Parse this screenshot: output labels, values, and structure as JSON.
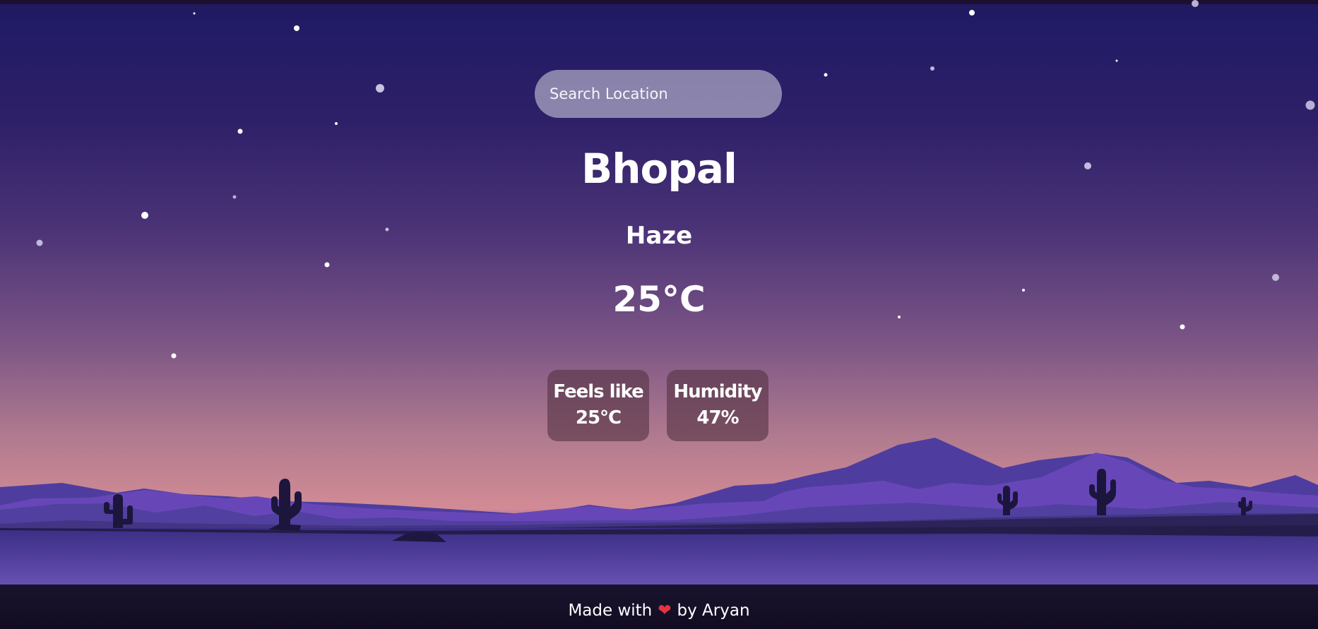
{
  "search": {
    "placeholder": "Search Location"
  },
  "weather": {
    "city": "Bhopal",
    "condition": "Haze",
    "temperature": "25°C",
    "feels_like": {
      "label": "Feels like",
      "value": "25°C"
    },
    "humidity": {
      "label": "Humidity",
      "value": "47%"
    }
  },
  "footer": {
    "prefix": "Made with",
    "heart": "❤",
    "suffix": "by Aryan"
  },
  "colors": {
    "sky_top": "#1f1a5e",
    "sky_bottom": "#d28b95",
    "footer_bg": "#120c22",
    "heart": "#e8323f"
  }
}
